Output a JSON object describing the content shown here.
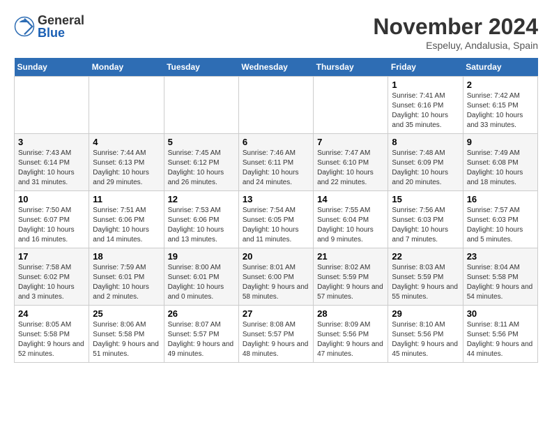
{
  "logo": {
    "general": "General",
    "blue": "Blue"
  },
  "title": "November 2024",
  "location": "Espeluy, Andalusia, Spain",
  "days_header": [
    "Sunday",
    "Monday",
    "Tuesday",
    "Wednesday",
    "Thursday",
    "Friday",
    "Saturday"
  ],
  "weeks": [
    [
      {
        "num": "",
        "info": ""
      },
      {
        "num": "",
        "info": ""
      },
      {
        "num": "",
        "info": ""
      },
      {
        "num": "",
        "info": ""
      },
      {
        "num": "",
        "info": ""
      },
      {
        "num": "1",
        "info": "Sunrise: 7:41 AM\nSunset: 6:16 PM\nDaylight: 10 hours and 35 minutes."
      },
      {
        "num": "2",
        "info": "Sunrise: 7:42 AM\nSunset: 6:15 PM\nDaylight: 10 hours and 33 minutes."
      }
    ],
    [
      {
        "num": "3",
        "info": "Sunrise: 7:43 AM\nSunset: 6:14 PM\nDaylight: 10 hours and 31 minutes."
      },
      {
        "num": "4",
        "info": "Sunrise: 7:44 AM\nSunset: 6:13 PM\nDaylight: 10 hours and 29 minutes."
      },
      {
        "num": "5",
        "info": "Sunrise: 7:45 AM\nSunset: 6:12 PM\nDaylight: 10 hours and 26 minutes."
      },
      {
        "num": "6",
        "info": "Sunrise: 7:46 AM\nSunset: 6:11 PM\nDaylight: 10 hours and 24 minutes."
      },
      {
        "num": "7",
        "info": "Sunrise: 7:47 AM\nSunset: 6:10 PM\nDaylight: 10 hours and 22 minutes."
      },
      {
        "num": "8",
        "info": "Sunrise: 7:48 AM\nSunset: 6:09 PM\nDaylight: 10 hours and 20 minutes."
      },
      {
        "num": "9",
        "info": "Sunrise: 7:49 AM\nSunset: 6:08 PM\nDaylight: 10 hours and 18 minutes."
      }
    ],
    [
      {
        "num": "10",
        "info": "Sunrise: 7:50 AM\nSunset: 6:07 PM\nDaylight: 10 hours and 16 minutes."
      },
      {
        "num": "11",
        "info": "Sunrise: 7:51 AM\nSunset: 6:06 PM\nDaylight: 10 hours and 14 minutes."
      },
      {
        "num": "12",
        "info": "Sunrise: 7:53 AM\nSunset: 6:06 PM\nDaylight: 10 hours and 13 minutes."
      },
      {
        "num": "13",
        "info": "Sunrise: 7:54 AM\nSunset: 6:05 PM\nDaylight: 10 hours and 11 minutes."
      },
      {
        "num": "14",
        "info": "Sunrise: 7:55 AM\nSunset: 6:04 PM\nDaylight: 10 hours and 9 minutes."
      },
      {
        "num": "15",
        "info": "Sunrise: 7:56 AM\nSunset: 6:03 PM\nDaylight: 10 hours and 7 minutes."
      },
      {
        "num": "16",
        "info": "Sunrise: 7:57 AM\nSunset: 6:03 PM\nDaylight: 10 hours and 5 minutes."
      }
    ],
    [
      {
        "num": "17",
        "info": "Sunrise: 7:58 AM\nSunset: 6:02 PM\nDaylight: 10 hours and 3 minutes."
      },
      {
        "num": "18",
        "info": "Sunrise: 7:59 AM\nSunset: 6:01 PM\nDaylight: 10 hours and 2 minutes."
      },
      {
        "num": "19",
        "info": "Sunrise: 8:00 AM\nSunset: 6:01 PM\nDaylight: 10 hours and 0 minutes."
      },
      {
        "num": "20",
        "info": "Sunrise: 8:01 AM\nSunset: 6:00 PM\nDaylight: 9 hours and 58 minutes."
      },
      {
        "num": "21",
        "info": "Sunrise: 8:02 AM\nSunset: 5:59 PM\nDaylight: 9 hours and 57 minutes."
      },
      {
        "num": "22",
        "info": "Sunrise: 8:03 AM\nSunset: 5:59 PM\nDaylight: 9 hours and 55 minutes."
      },
      {
        "num": "23",
        "info": "Sunrise: 8:04 AM\nSunset: 5:58 PM\nDaylight: 9 hours and 54 minutes."
      }
    ],
    [
      {
        "num": "24",
        "info": "Sunrise: 8:05 AM\nSunset: 5:58 PM\nDaylight: 9 hours and 52 minutes."
      },
      {
        "num": "25",
        "info": "Sunrise: 8:06 AM\nSunset: 5:58 PM\nDaylight: 9 hours and 51 minutes."
      },
      {
        "num": "26",
        "info": "Sunrise: 8:07 AM\nSunset: 5:57 PM\nDaylight: 9 hours and 49 minutes."
      },
      {
        "num": "27",
        "info": "Sunrise: 8:08 AM\nSunset: 5:57 PM\nDaylight: 9 hours and 48 minutes."
      },
      {
        "num": "28",
        "info": "Sunrise: 8:09 AM\nSunset: 5:56 PM\nDaylight: 9 hours and 47 minutes."
      },
      {
        "num": "29",
        "info": "Sunrise: 8:10 AM\nSunset: 5:56 PM\nDaylight: 9 hours and 45 minutes."
      },
      {
        "num": "30",
        "info": "Sunrise: 8:11 AM\nSunset: 5:56 PM\nDaylight: 9 hours and 44 minutes."
      }
    ]
  ]
}
